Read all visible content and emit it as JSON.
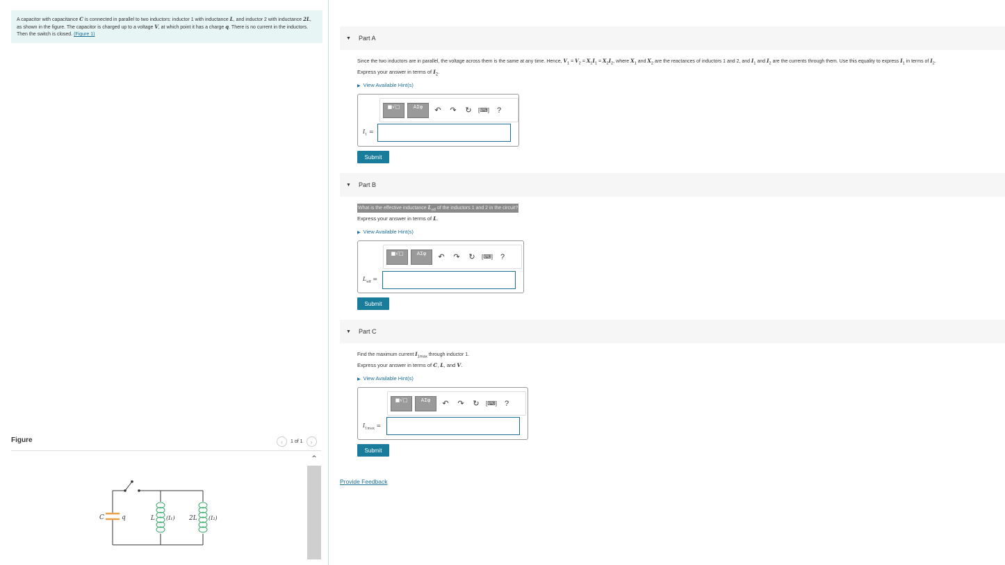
{
  "intro": {
    "t1": "A capacitor with capacitance ",
    "v_c": "C",
    "t2": " is connected in parallel to two inductors: inductor 1 with inductance ",
    "v_l": "L",
    "t3": ", and inductor 2 with inductance ",
    "v_2l": "2L",
    "t4": ", as shown in the figure. The capacitor is charged up to a voltage ",
    "v_v": "V",
    "t5": ", at which point it has a charge ",
    "v_q": "q",
    "t6": ". There is no current in the inductors. Then the switch is closed. ",
    "figure_link": "(Figure 1)"
  },
  "figure": {
    "title": "Figure",
    "counter": "1 of 1",
    "labels": {
      "c": "C",
      "q": "q",
      "l": "L",
      "i1": "(I₁)",
      "two_l": "2L",
      "i2": "(I₂)"
    }
  },
  "toolbar": {
    "templates": "■√□",
    "symbols": "AΣφ",
    "undo": "↶",
    "redo": "↷",
    "reset": "↻",
    "keyboard": "[⌨]",
    "help": "?"
  },
  "parts": [
    {
      "head": "Part A",
      "question": "Since the two inductors are in parallel, the voltage across them is the same at any time. Hence, V₁ = V₂ = X₁I₁ = X₂I₂, where X₁ and X₂ are the reactances of inductors 1 and 2, and I₁ and I₂ are the currents through them. Use this equality to express I₁ in terms of I₂.",
      "express": "Express your answer in terms of I₂.",
      "hint": "View Available Hint(s)",
      "var": "I₁ =",
      "submit": "Submit"
    },
    {
      "head": "Part B",
      "question": "What is the effective inductance L_eff of the inductors 1 and 2 in the circuit?",
      "express": "Express your answer in terms of L.",
      "hint": "View Available Hint(s)",
      "var": "L_eff =",
      "submit": "Submit"
    },
    {
      "head": "Part C",
      "question": "Find the maximum current I_1max through inductor 1.",
      "express": "Express your answer in terms of C, L, and V.",
      "hint": "View Available Hint(s)",
      "var": "I_1max =",
      "submit": "Submit"
    }
  ],
  "feedback": "Provide Feedback"
}
